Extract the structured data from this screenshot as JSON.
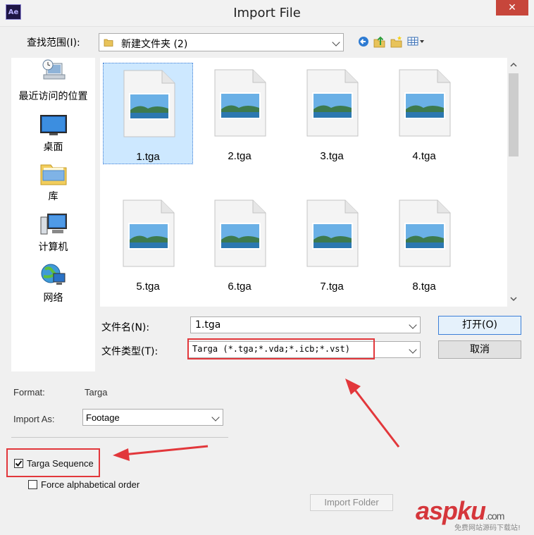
{
  "window": {
    "title": "Import File",
    "app_icon_text": "Ae",
    "close_glyph": "✕"
  },
  "lookin": {
    "label": "查找范围(I):",
    "value": "新建文件夹 (2)"
  },
  "places": [
    {
      "label": "最近访问的位置",
      "icon": "recent-places-icon"
    },
    {
      "label": "桌面",
      "icon": "desktop-icon"
    },
    {
      "label": "库",
      "icon": "library-icon"
    },
    {
      "label": "计算机",
      "icon": "computer-icon"
    },
    {
      "label": "网络",
      "icon": "network-icon"
    }
  ],
  "files": [
    "1.tga",
    "2.tga",
    "3.tga",
    "4.tga",
    "5.tga",
    "6.tga",
    "7.tga",
    "8.tga"
  ],
  "selected_file": "1.tga",
  "filename": {
    "label": "文件名(N):",
    "value": "1.tga"
  },
  "filetype": {
    "label": "文件类型(T):",
    "value": "Targa (*.tga;*.vda;*.icb;*.vst)"
  },
  "buttons": {
    "open": "打开(O)",
    "cancel": "取消",
    "import_folder": "Import Folder"
  },
  "format": {
    "label": "Format:",
    "value": "Targa"
  },
  "import_as": {
    "label": "Import As:",
    "value": "Footage"
  },
  "options": {
    "sequence": {
      "label": "Targa Sequence",
      "checked": true
    },
    "alpha_order": {
      "label": "Force alphabetical order",
      "checked": false
    }
  },
  "watermark": {
    "text": "aspku",
    "suffix": ".com",
    "sub": "免费网站源码下载站!"
  },
  "colors": {
    "highlight": "#e2373b",
    "selection": "#cde8ff"
  }
}
